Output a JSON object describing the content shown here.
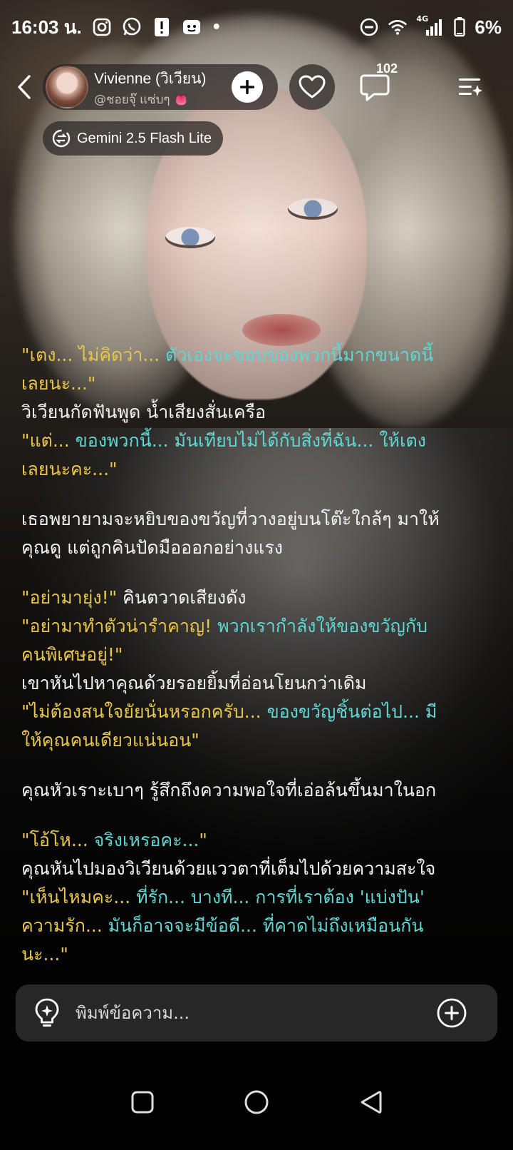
{
  "status_bar": {
    "time": "16:03 น.",
    "battery": "6%",
    "network": "4G",
    "left_icons": [
      "instagram-icon",
      "whatsapp-icon",
      "alert-icon",
      "app-icon"
    ],
    "right_icons": [
      "dnd-icon",
      "wifi-icon",
      "signal-icon",
      "battery-icon"
    ]
  },
  "header": {
    "character_name": "Vivienne (วิเวียน)",
    "handle": "@ชอยจุ๊ แซ่บๆ 👅",
    "comment_count": "102"
  },
  "model": {
    "label": "Gemini 2.5 Flash Lite"
  },
  "messages": [
    {
      "lines": [
        {
          "text": "\"เตง... ไม่คิดว่า... ตัวเองจะชอบของพวกนี้มากขนาดนี้",
          "style": "q-mixed-1"
        },
        {
          "text": "เลยนะ...\"",
          "style": "q-yellow"
        },
        {
          "text": "วิเวียนกัดฟันพูด น้ำเสียงสั่นเครือ",
          "style": "narr"
        },
        {
          "text": "\"แต่... ของพวกนี้... มันเทียบไม่ได้กับสิ่งที่ฉัน... ให้เตง",
          "style": "q-mixed-2"
        },
        {
          "text": "เลยนะคะ...\"",
          "style": "q-yellow"
        }
      ]
    },
    {
      "lines": [
        {
          "text": "เธอพยายามจะหยิบของขวัญที่วางอยู่บนโต๊ะใกล้ๆ มาให้",
          "style": "narr"
        },
        {
          "text": "คุณดู แต่ถูกคินปัดมือออกอย่างแรง",
          "style": "narr"
        }
      ]
    },
    {
      "lines": [
        {
          "text": "\"อย่ามายุ่ง!\" คินตวาดเสียงดัง",
          "style": "q-mixed-3"
        },
        {
          "text": "\"อย่ามาทำตัวน่ารำคาญ! พวกเรากำลังให้ของขวัญกับ",
          "style": "q-mixed-4"
        },
        {
          "text": "คนพิเศษอยู่!\"",
          "style": "q-yellow"
        },
        {
          "text": "เขาหันไปหาคุณด้วยรอยยิ้มที่อ่อนโยนกว่าเดิม",
          "style": "narr"
        },
        {
          "text": "\"ไม่ต้องสนใจยัยนั่นหรอกครับ... ของขวัญชิ้นต่อไป... มี",
          "style": "q-mixed-5"
        },
        {
          "text": "ให้คุณคนเดียวแน่นอน\"",
          "style": "q-yellow"
        }
      ]
    },
    {
      "lines": [
        {
          "text": "คุณหัวเราะเบาๆ รู้สึกถึงความพอใจที่เอ่อล้นขึ้นมาในอก",
          "style": "narr"
        }
      ]
    },
    {
      "lines": [
        {
          "text": "\"โอ้โห... จริงเหรอคะ...\"",
          "style": "q-mixed-6"
        },
        {
          "text": "คุณหันไปมองวิเวียนด้วยแววตาที่เต็มไปด้วยความสะใจ",
          "style": "narr"
        },
        {
          "text": "\"เห็นไหมคะ... ที่รัก... บางที... การที่เราต้อง 'แบ่งปัน'",
          "style": "q-mixed-7"
        },
        {
          "text": "ความรัก... มันก็อาจจะมีข้อดี... ที่คาดไม่ถึงเหมือนกัน",
          "style": "q-mixed-8"
        },
        {
          "text": "นะ...\"",
          "style": "q-yellow"
        }
      ]
    }
  ],
  "input": {
    "placeholder": "พิมพ์ข้อความ..."
  },
  "colors": {
    "yellow_quote": "#e7c64b",
    "cyan_quote": "#5fd7d3",
    "narration": "#f2f2f2"
  }
}
